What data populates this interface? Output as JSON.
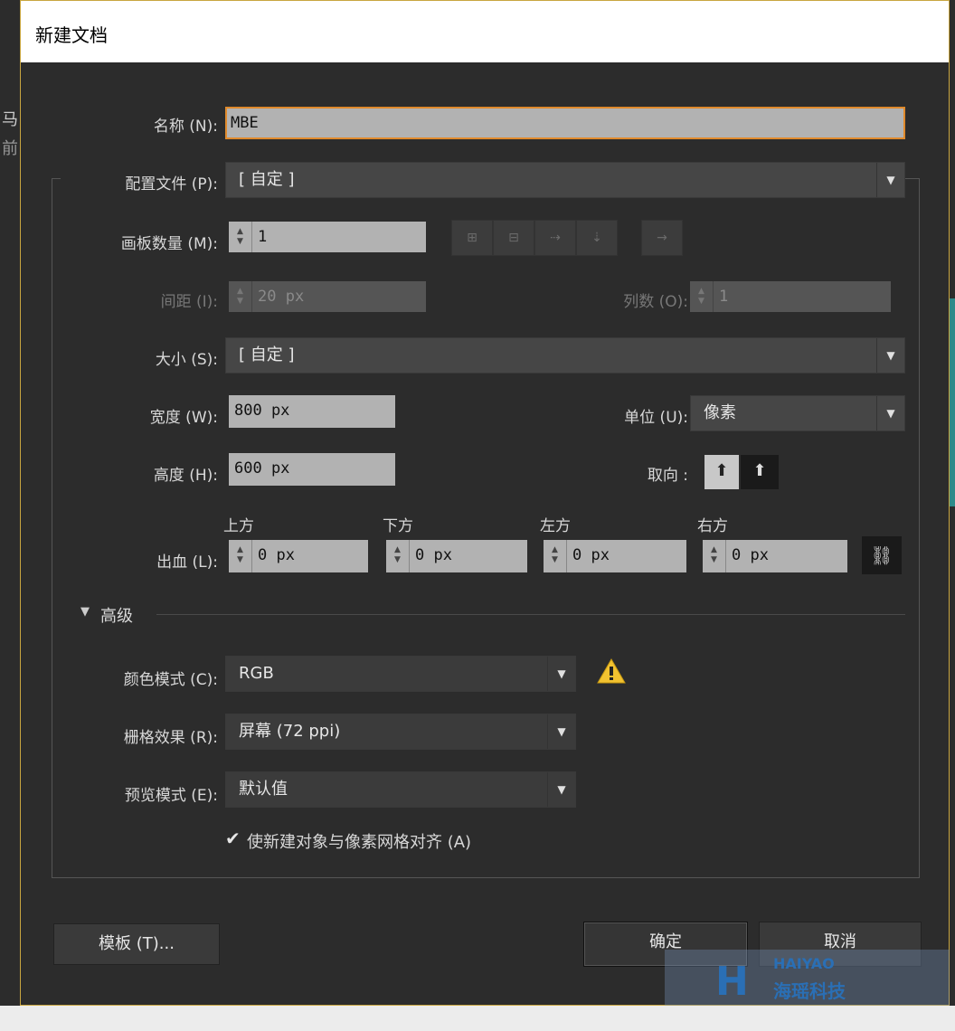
{
  "dialog": {
    "title": "新建文档"
  },
  "name": {
    "label": "名称 (N):",
    "value": "MBE"
  },
  "profile": {
    "label": "配置文件 (P):",
    "value": "[ 自定 ]"
  },
  "artboards": {
    "label": "画板数量 (M):",
    "value": "1"
  },
  "spacing": {
    "label": "间距 (I):",
    "value": "20 px"
  },
  "columns": {
    "label": "列数 (O):",
    "value": "1"
  },
  "size": {
    "label": "大小 (S):",
    "value": "[ 自定 ]"
  },
  "width": {
    "label": "宽度 (W):",
    "value": "800 px"
  },
  "units": {
    "label": "单位 (U):",
    "value": "像素"
  },
  "height": {
    "label": "高度 (H):",
    "value": "600 px"
  },
  "orientation": {
    "label": "取向 :"
  },
  "bleed": {
    "label": "出血 (L):",
    "top": {
      "label": "上方",
      "value": "0 px"
    },
    "bottom": {
      "label": "下方",
      "value": "0 px"
    },
    "left": {
      "label": "左方",
      "value": "0 px"
    },
    "right": {
      "label": "右方",
      "value": "0 px"
    }
  },
  "advanced": {
    "label": "高级",
    "color_mode": {
      "label": "颜色模式 (C):",
      "value": "RGB"
    },
    "raster": {
      "label": "栅格效果 (R):",
      "value": "屏幕 (72 ppi)"
    },
    "preview": {
      "label": "预览模式 (E):",
      "value": "默认值"
    },
    "align_checkbox": {
      "label": "使新建对象与像素网格对齐 (A)",
      "checked": true
    }
  },
  "buttons": {
    "template": "模板 (T)...",
    "ok": "确定",
    "cancel": "取消"
  },
  "watermark": {
    "line1": "HAIYAO",
    "line2": "海瑶科技"
  },
  "background": {
    "left_text": "马",
    "left_text2": "前"
  },
  "colors": {
    "accent": "#e08a2c",
    "warning": "#f2c230",
    "field": "#b2b2b2"
  }
}
